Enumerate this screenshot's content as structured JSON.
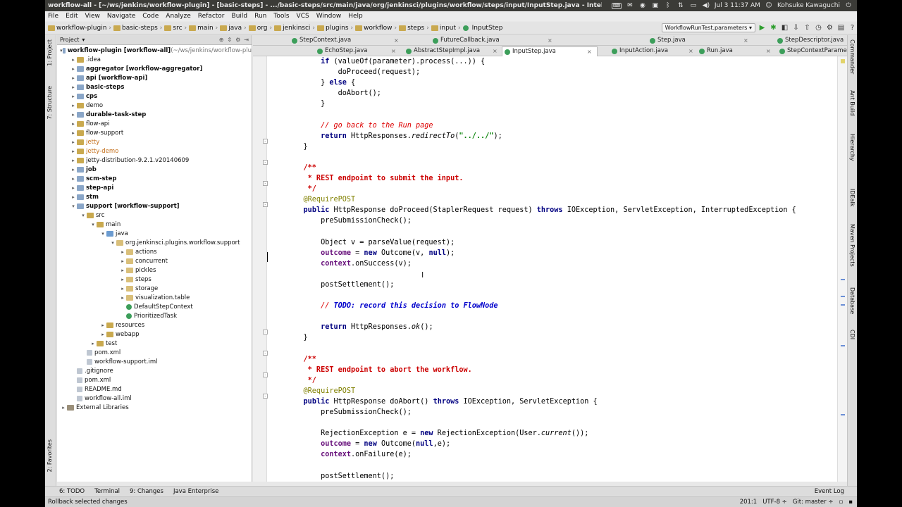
{
  "window": {
    "title": "workflow-all - [~/ws/jenkins/workflow-plugin] - [basic-steps] - .../basic-steps/src/main/java/org/jenkinsci/plugins/workflow/steps/input/InputStep.java - IntelliJ ID",
    "clock": "Jul  3 11:37 AM",
    "user": "Kohsuke Kawaguchi"
  },
  "menu": [
    "File",
    "Edit",
    "View",
    "Navigate",
    "Code",
    "Analyze",
    "Refactor",
    "Build",
    "Run",
    "Tools",
    "VCS",
    "Window",
    "Help"
  ],
  "breadcrumb": [
    "workflow-plugin",
    "basic-steps",
    "src",
    "main",
    "java",
    "org",
    "jenkinsci",
    "plugins",
    "workflow",
    "steps",
    "input",
    "InputStep"
  ],
  "run_config": "WorkflowRunTest.parameters",
  "project_panel": {
    "header": "Project",
    "tree": [
      {
        "indent": 0,
        "arrow": "▾",
        "icon": "module",
        "label": "workflow-plugin [workflow-all]",
        "suffix": " (~/ws/jenkins/workflow-plu",
        "bold": true
      },
      {
        "indent": 1,
        "arrow": "▸",
        "icon": "folder",
        "label": ".idea"
      },
      {
        "indent": 1,
        "arrow": "▸",
        "icon": "module",
        "label": "aggregator [workflow-aggregator]",
        "bold": true
      },
      {
        "indent": 1,
        "arrow": "▸",
        "icon": "module",
        "label": "api [workflow-api]",
        "bold": true
      },
      {
        "indent": 1,
        "arrow": "▸",
        "icon": "module",
        "label": "basic-steps",
        "bold": true
      },
      {
        "indent": 1,
        "arrow": "▸",
        "icon": "module",
        "label": "cps",
        "bold": true
      },
      {
        "indent": 1,
        "arrow": "▸",
        "icon": "folder",
        "label": "demo"
      },
      {
        "indent": 1,
        "arrow": "▸",
        "icon": "module",
        "label": "durable-task-step",
        "bold": true
      },
      {
        "indent": 1,
        "arrow": "▸",
        "icon": "folder",
        "label": "flow-api"
      },
      {
        "indent": 1,
        "arrow": "▸",
        "icon": "folder",
        "label": "flow-support"
      },
      {
        "indent": 1,
        "arrow": "▸",
        "icon": "folder",
        "label": "jetty",
        "orange": true
      },
      {
        "indent": 1,
        "arrow": "▸",
        "icon": "folder",
        "label": "jetty-demo",
        "orange": true
      },
      {
        "indent": 1,
        "arrow": "▸",
        "icon": "folder",
        "label": "jetty-distribution-9.2.1.v20140609"
      },
      {
        "indent": 1,
        "arrow": "▸",
        "icon": "module",
        "label": "job",
        "bold": true
      },
      {
        "indent": 1,
        "arrow": "▸",
        "icon": "module",
        "label": "scm-step",
        "bold": true
      },
      {
        "indent": 1,
        "arrow": "▸",
        "icon": "module",
        "label": "step-api",
        "bold": true
      },
      {
        "indent": 1,
        "arrow": "▸",
        "icon": "module",
        "label": "stm",
        "bold": true
      },
      {
        "indent": 1,
        "arrow": "▾",
        "icon": "module",
        "label": "support [workflow-support]",
        "bold": true
      },
      {
        "indent": 2,
        "arrow": "▾",
        "icon": "folder",
        "label": "src"
      },
      {
        "indent": 3,
        "arrow": "▾",
        "icon": "folder",
        "label": "main"
      },
      {
        "indent": 4,
        "arrow": "▾",
        "icon": "src",
        "label": "java"
      },
      {
        "indent": 5,
        "arrow": "▾",
        "icon": "pkg",
        "label": "org.jenkinsci.plugins.workflow.support"
      },
      {
        "indent": 6,
        "arrow": "▸",
        "icon": "pkg",
        "label": "actions"
      },
      {
        "indent": 6,
        "arrow": "▸",
        "icon": "pkg",
        "label": "concurrent"
      },
      {
        "indent": 6,
        "arrow": "▸",
        "icon": "pkg",
        "label": "pickles"
      },
      {
        "indent": 6,
        "arrow": "▸",
        "icon": "pkg",
        "label": "steps"
      },
      {
        "indent": 6,
        "arrow": "▸",
        "icon": "pkg",
        "label": "storage"
      },
      {
        "indent": 6,
        "arrow": "▸",
        "icon": "pkg",
        "label": "visualization.table"
      },
      {
        "indent": 6,
        "arrow": "",
        "icon": "cls",
        "label": "DefaultStepContext"
      },
      {
        "indent": 6,
        "arrow": "",
        "icon": "cls",
        "label": "PrioritizedTask"
      },
      {
        "indent": 4,
        "arrow": "▸",
        "icon": "folder",
        "label": "resources"
      },
      {
        "indent": 4,
        "arrow": "▸",
        "icon": "folder",
        "label": "webapp"
      },
      {
        "indent": 3,
        "arrow": "▸",
        "icon": "folder",
        "label": "test"
      },
      {
        "indent": 2,
        "arrow": "",
        "icon": "file",
        "label": "pom.xml"
      },
      {
        "indent": 2,
        "arrow": "",
        "icon": "file",
        "label": "workflow-support.iml"
      },
      {
        "indent": 1,
        "arrow": "",
        "icon": "file",
        "label": ".gitignore"
      },
      {
        "indent": 1,
        "arrow": "",
        "icon": "file",
        "label": "pom.xml"
      },
      {
        "indent": 1,
        "arrow": "",
        "icon": "file",
        "label": "README.md"
      },
      {
        "indent": 1,
        "arrow": "",
        "icon": "file",
        "label": "workflow-all.iml"
      },
      {
        "indent": 0,
        "arrow": "▸",
        "icon": "lib",
        "label": "External Libraries"
      }
    ]
  },
  "tabs": {
    "row1": [
      "StepContext.java",
      "FutureCallback.java",
      "Step.java",
      "StepDescriptor.java"
    ],
    "row2": [
      "EchoStep.java",
      "AbstractStepImpl.java",
      "InputStep.java",
      "InputAction.java",
      "Run.java",
      "StepContextParameter.java"
    ],
    "active": "InputStep.java"
  },
  "code": [
    "        if (valueOf(parameter).process(...)) {",
    "            doProceed(request);",
    "        } else {",
    "            doAbort();",
    "        }",
    "",
    "        // go back to the Run page",
    "        return HttpResponses.redirectTo(\"../../\");",
    "    }",
    "",
    "    /**",
    "     * REST endpoint to submit the input.",
    "     */",
    "    @RequirePOST",
    "    public HttpResponse doProceed(StaplerRequest request) throws IOException, ServletException, InterruptedException {",
    "        preSubmissionCheck();",
    "",
    "        Object v = parseValue(request);",
    "        outcome = new Outcome(v, null);",
    "        context.onSuccess(v);",
    "",
    "        postSettlement();",
    "",
    "        // TODO: record this decision to FlowNode",
    "",
    "        return HttpResponses.ok();",
    "    }",
    "",
    "    /**",
    "     * REST endpoint to abort the workflow.",
    "     */",
    "    @RequirePOST",
    "    public HttpResponse doAbort() throws IOException, ServletException {",
    "        preSubmissionCheck();",
    "",
    "        RejectionException e = new RejectionException(User.current());",
    "        outcome = new Outcome(null,e);",
    "        context.onFailure(e);",
    "",
    "        postSettlement();"
  ],
  "tool_windows": {
    "left": [
      "1: Project",
      "7: Structure",
      "2: Favorites"
    ],
    "right": [
      "Commander",
      "Ant Build",
      "Hierarchy",
      "IDEalk",
      "Maven Projects",
      "Database",
      "CDI"
    ],
    "bottom": [
      "6: TODO",
      "Terminal",
      "9: Changes",
      "Java Enterprise"
    ],
    "event_log": "Event Log"
  },
  "status": {
    "message": "Rollback selected changes",
    "position": "201:1",
    "encoding": "UTF-8 ÷",
    "git": "Git: master ÷"
  },
  "colors": {
    "keyword": "#000080",
    "comment": "#d00000",
    "annotation": "#808000",
    "field": "#660e7a",
    "string": "#008000"
  }
}
